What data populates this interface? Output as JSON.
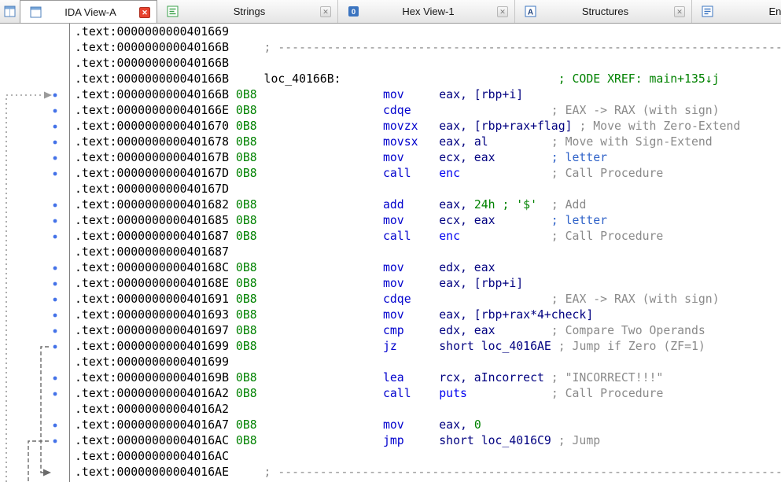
{
  "tab_bar": {
    "tabs": [
      {
        "label": "IDA View-A",
        "active": true,
        "icon": "ida-view-icon"
      },
      {
        "label": "Strings",
        "active": false,
        "icon": "strings-icon"
      },
      {
        "label": "Hex View-1",
        "active": false,
        "icon": "hex-view-icon"
      },
      {
        "label": "Structures",
        "active": false,
        "icon": "structures-icon"
      },
      {
        "label": "Enum",
        "active": false,
        "icon": "enum-icon"
      }
    ]
  },
  "icons": {
    "close": "✕"
  },
  "palette": {
    "k": "#000000",
    "g": "#008200",
    "m": "#0000cd",
    "o": "#000080",
    "f": "#0000f0",
    "c": "#8a8a8a",
    "u": "#2f62c8",
    "dot": "#4472e8",
    "arrow_in": "#9a9a9a",
    "arrow_jump": "#6b6b6b"
  },
  "listing": {
    "lines": [
      {
        "segs": [
          [
            "k",
            ".text:0000000000401669"
          ]
        ]
      },
      {
        "segs": [
          [
            "k",
            ".text:000000000040166B"
          ],
          [
            "c",
            "     ; ------------------------------------------------------------------------------------------"
          ]
        ]
      },
      {
        "segs": [
          [
            "k",
            ".text:000000000040166B"
          ]
        ]
      },
      {
        "segs": [
          [
            "k",
            ".text:000000000040166B"
          ],
          [
            "k",
            "     loc_40166B:"
          ],
          [
            "g",
            "                               ; CODE XREF: main+135↓j"
          ]
        ]
      },
      {
        "segs": [
          [
            "k",
            ".text:000000000040166B"
          ],
          [
            "g",
            " 0B8"
          ],
          [
            "m",
            "                  mov"
          ],
          [
            "o",
            "     eax, [rbp+i]"
          ]
        ]
      },
      {
        "segs": [
          [
            "k",
            ".text:000000000040166E"
          ],
          [
            "g",
            " 0B8"
          ],
          [
            "m",
            "                  cdqe"
          ],
          [
            "c",
            "                    ; EAX -> RAX (with sign)"
          ]
        ]
      },
      {
        "segs": [
          [
            "k",
            ".text:0000000000401670"
          ],
          [
            "g",
            " 0B8"
          ],
          [
            "m",
            "                  movzx"
          ],
          [
            "o",
            "   eax, [rbp+rax+flag]"
          ],
          [
            "c",
            " ; Move with Zero-Extend"
          ]
        ]
      },
      {
        "segs": [
          [
            "k",
            ".text:0000000000401678"
          ],
          [
            "g",
            " 0B8"
          ],
          [
            "m",
            "                  movsx"
          ],
          [
            "o",
            "   eax, al"
          ],
          [
            "c",
            "         ; Move with Sign-Extend"
          ]
        ]
      },
      {
        "segs": [
          [
            "k",
            ".text:000000000040167B"
          ],
          [
            "g",
            " 0B8"
          ],
          [
            "m",
            "                  mov"
          ],
          [
            "o",
            "     ecx, eax"
          ],
          [
            "u",
            "        ; letter"
          ]
        ]
      },
      {
        "segs": [
          [
            "k",
            ".text:000000000040167D"
          ],
          [
            "g",
            " 0B8"
          ],
          [
            "m",
            "                  call"
          ],
          [
            "f",
            "    enc"
          ],
          [
            "c",
            "             ; Call Procedure"
          ]
        ]
      },
      {
        "segs": [
          [
            "k",
            ".text:000000000040167D"
          ]
        ]
      },
      {
        "segs": [
          [
            "k",
            ".text:0000000000401682"
          ],
          [
            "g",
            " 0B8"
          ],
          [
            "m",
            "                  add"
          ],
          [
            "o",
            "     eax, "
          ],
          [
            "g",
            "24h ; '$'"
          ],
          [
            "c",
            "  ; Add"
          ]
        ]
      },
      {
        "segs": [
          [
            "k",
            ".text:0000000000401685"
          ],
          [
            "g",
            " 0B8"
          ],
          [
            "m",
            "                  mov"
          ],
          [
            "o",
            "     ecx, eax"
          ],
          [
            "u",
            "        ; letter"
          ]
        ]
      },
      {
        "segs": [
          [
            "k",
            ".text:0000000000401687"
          ],
          [
            "g",
            " 0B8"
          ],
          [
            "m",
            "                  call"
          ],
          [
            "f",
            "    enc"
          ],
          [
            "c",
            "             ; Call Procedure"
          ]
        ]
      },
      {
        "segs": [
          [
            "k",
            ".text:0000000000401687"
          ]
        ]
      },
      {
        "segs": [
          [
            "k",
            ".text:000000000040168C"
          ],
          [
            "g",
            " 0B8"
          ],
          [
            "m",
            "                  mov"
          ],
          [
            "o",
            "     edx, eax"
          ]
        ]
      },
      {
        "segs": [
          [
            "k",
            ".text:000000000040168E"
          ],
          [
            "g",
            " 0B8"
          ],
          [
            "m",
            "                  mov"
          ],
          [
            "o",
            "     eax, [rbp+i]"
          ]
        ]
      },
      {
        "segs": [
          [
            "k",
            ".text:0000000000401691"
          ],
          [
            "g",
            " 0B8"
          ],
          [
            "m",
            "                  cdqe"
          ],
          [
            "c",
            "                    ; EAX -> RAX (with sign)"
          ]
        ]
      },
      {
        "segs": [
          [
            "k",
            ".text:0000000000401693"
          ],
          [
            "g",
            " 0B8"
          ],
          [
            "m",
            "                  mov"
          ],
          [
            "o",
            "     eax, [rbp+rax*4+check]"
          ]
        ]
      },
      {
        "segs": [
          [
            "k",
            ".text:0000000000401697"
          ],
          [
            "g",
            " 0B8"
          ],
          [
            "m",
            "                  cmp"
          ],
          [
            "o",
            "     edx, eax"
          ],
          [
            "c",
            "        ; Compare Two Operands"
          ]
        ]
      },
      {
        "segs": [
          [
            "k",
            ".text:0000000000401699"
          ],
          [
            "g",
            " 0B8"
          ],
          [
            "m",
            "                  jz"
          ],
          [
            "o",
            "      short loc_4016AE"
          ],
          [
            "c",
            " ; Jump if Zero (ZF=1)"
          ]
        ]
      },
      {
        "segs": [
          [
            "k",
            ".text:0000000000401699"
          ]
        ]
      },
      {
        "segs": [
          [
            "k",
            ".text:000000000040169B"
          ],
          [
            "g",
            " 0B8"
          ],
          [
            "m",
            "                  lea"
          ],
          [
            "o",
            "     rcx, aIncorrect"
          ],
          [
            "c",
            " ; \"INCORRECT!!!\""
          ]
        ]
      },
      {
        "segs": [
          [
            "k",
            ".text:00000000004016A2"
          ],
          [
            "g",
            " 0B8"
          ],
          [
            "m",
            "                  call"
          ],
          [
            "f",
            "    puts"
          ],
          [
            "c",
            "            ; Call Procedure"
          ]
        ]
      },
      {
        "segs": [
          [
            "k",
            ".text:00000000004016A2"
          ]
        ]
      },
      {
        "segs": [
          [
            "k",
            ".text:00000000004016A7"
          ],
          [
            "g",
            " 0B8"
          ],
          [
            "m",
            "                  mov"
          ],
          [
            "o",
            "     eax, "
          ],
          [
            "g",
            "0"
          ]
        ]
      },
      {
        "segs": [
          [
            "k",
            ".text:00000000004016AC"
          ],
          [
            "g",
            " 0B8"
          ],
          [
            "m",
            "                  jmp"
          ],
          [
            "o",
            "     short loc_4016C9"
          ],
          [
            "c",
            " ; Jump"
          ]
        ]
      },
      {
        "segs": [
          [
            "k",
            ".text:00000000004016AC"
          ]
        ]
      },
      {
        "segs": [
          [
            "k",
            ".text:00000000004016AE"
          ],
          [
            "c",
            "     ; ------------------------------------------------------------------------------------------"
          ]
        ]
      }
    ]
  }
}
